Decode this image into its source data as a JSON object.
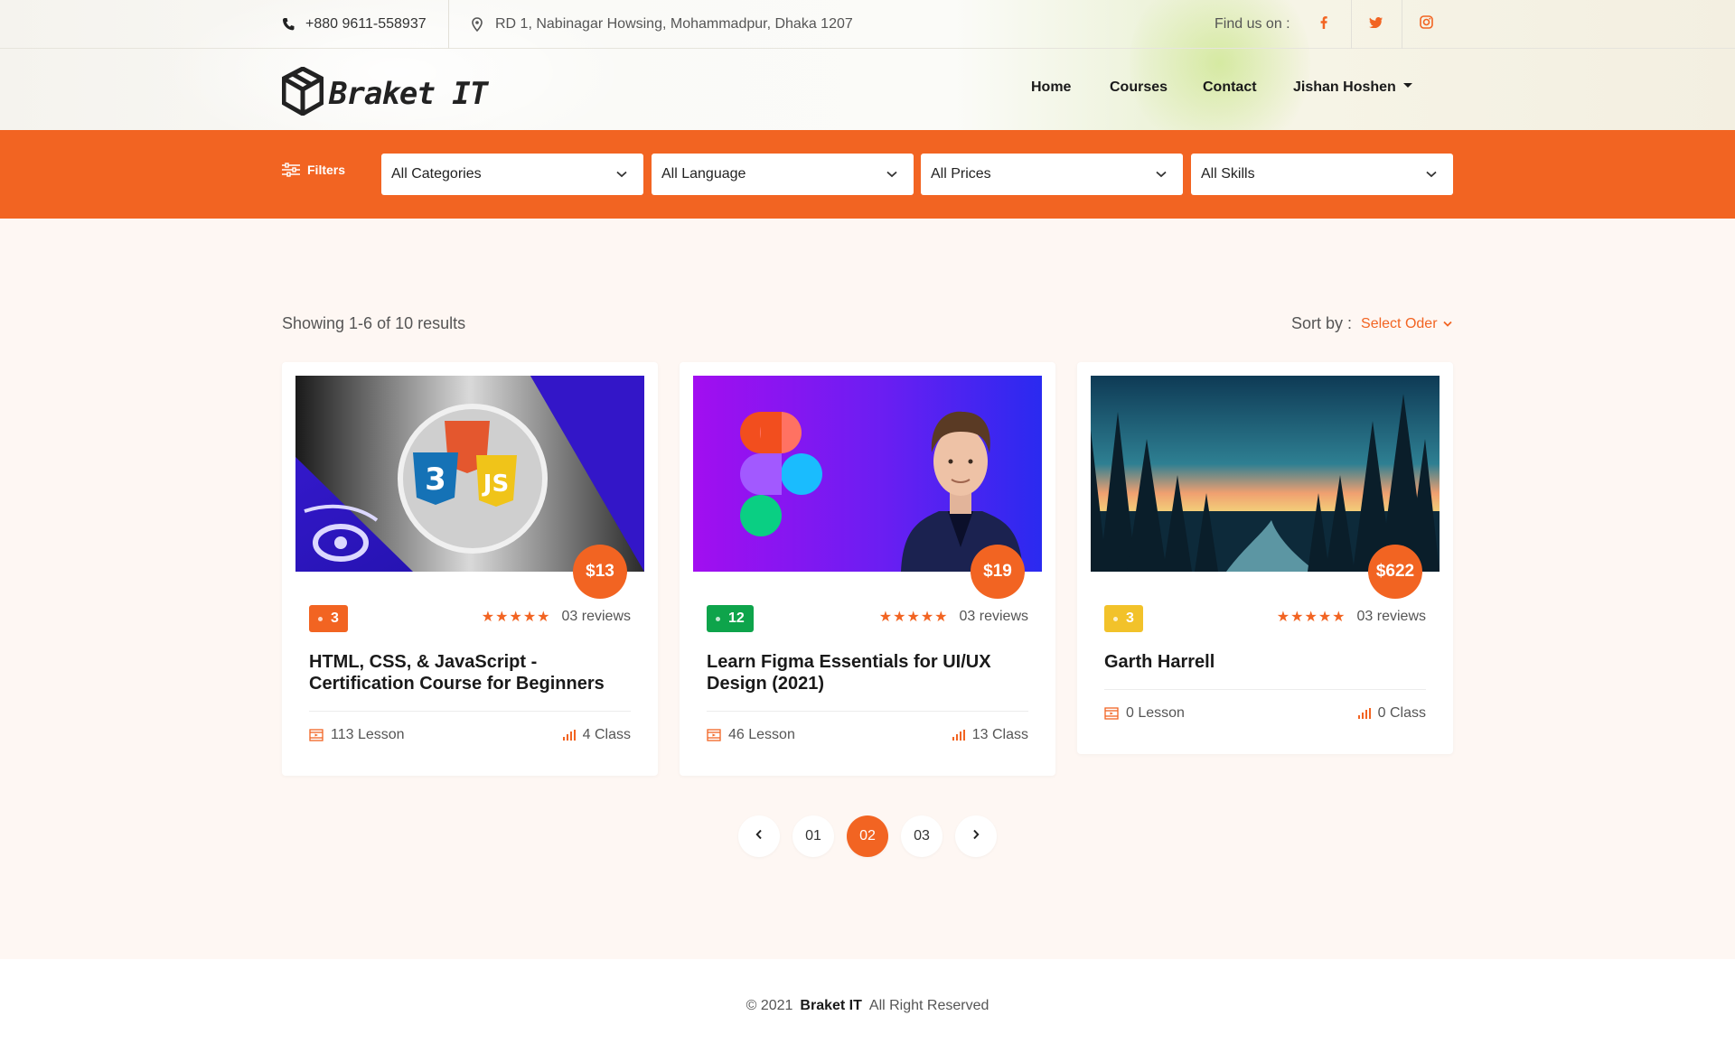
{
  "topbar": {
    "phone": "+880 9611-558937",
    "address": "RD 1, Nabinagar Howsing, Mohammadpur, Dhaka 1207",
    "find_us": "Find us on :",
    "social_icons": [
      "facebook-icon",
      "twitter-icon",
      "instagram-icon"
    ]
  },
  "brand": {
    "name": "Braket IT",
    "accent": "#f26422"
  },
  "nav": {
    "home": "Home",
    "courses": "Courses",
    "contact": "Contact",
    "user": "Jishan Hoshen"
  },
  "filters": {
    "label": "Filters",
    "categories": "All Categories",
    "language": "All Language",
    "prices": "All Prices",
    "skills": "All Skills"
  },
  "results": {
    "showing": "Showing 1-6 of 10 results",
    "sort_label": "Sort by :",
    "sort_value": "Select Oder"
  },
  "courses": [
    {
      "price": "$13",
      "badge": "3",
      "badge_color": "#f26422",
      "reviews": "03 reviews",
      "title": "HTML, CSS, & JavaScript - Certification Course for Beginners",
      "lessons": "113 Lesson",
      "classes": "4 Class"
    },
    {
      "price": "$19",
      "badge": "12",
      "badge_color": "#0ea44b",
      "reviews": "03 reviews",
      "title": "Learn Figma Essentials for UI/UX Design (2021)",
      "lessons": "46 Lesson",
      "classes": "13 Class"
    },
    {
      "price": "$622",
      "badge": "3",
      "badge_color": "#f2c22a",
      "reviews": "03 reviews",
      "title": "Garth Harrell",
      "lessons": "0 Lesson",
      "classes": "0 Class"
    }
  ],
  "pagination": {
    "pages": [
      "01",
      "02",
      "03"
    ],
    "active": "02"
  },
  "footer": {
    "copyright": "© 2021",
    "brand": "Braket IT",
    "rights": "All Right Reserved"
  }
}
